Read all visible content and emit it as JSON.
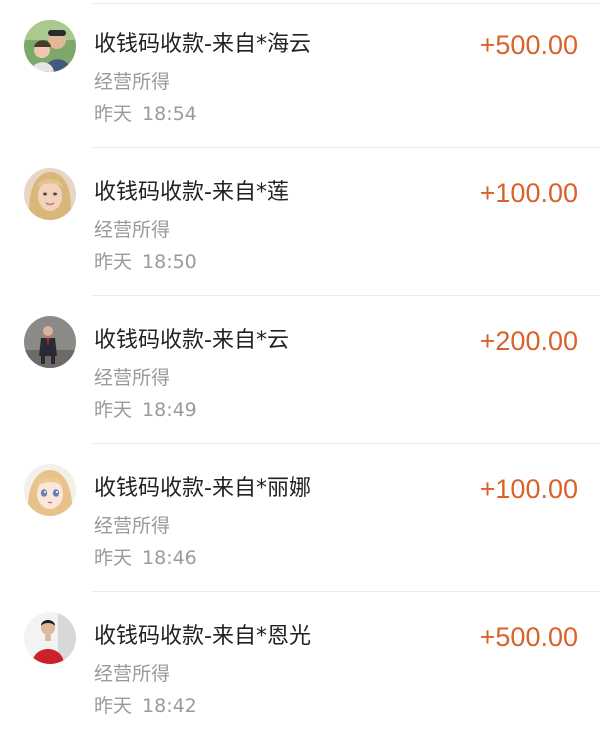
{
  "transactions": [
    {
      "title": "收钱码收款-来自*海云",
      "category": "经营所得",
      "day": "昨天",
      "time": "18:54",
      "amount": "+500.00",
      "avatar": "couple-photo-avatar"
    },
    {
      "title": "收钱码收款-来自*莲",
      "category": "经营所得",
      "day": "昨天",
      "time": "18:50",
      "amount": "+100.00",
      "avatar": "blonde-woman-avatar"
    },
    {
      "title": "收钱码收款-来自*云",
      "category": "经营所得",
      "day": "昨天",
      "time": "18:49",
      "amount": "+200.00",
      "avatar": "man-in-suit-avatar"
    },
    {
      "title": "收钱码收款-来自*丽娜",
      "category": "经营所得",
      "day": "昨天",
      "time": "18:46",
      "amount": "+100.00",
      "avatar": "anime-girl-avatar"
    },
    {
      "title": "收钱码收款-来自*恩光",
      "category": "经营所得",
      "day": "昨天",
      "time": "18:42",
      "amount": "+500.00",
      "avatar": "man-red-shirt-avatar"
    }
  ],
  "colors": {
    "amount": "#d9622b",
    "title": "#222222",
    "secondary": "#9a9a9a",
    "divider": "#ececec"
  }
}
